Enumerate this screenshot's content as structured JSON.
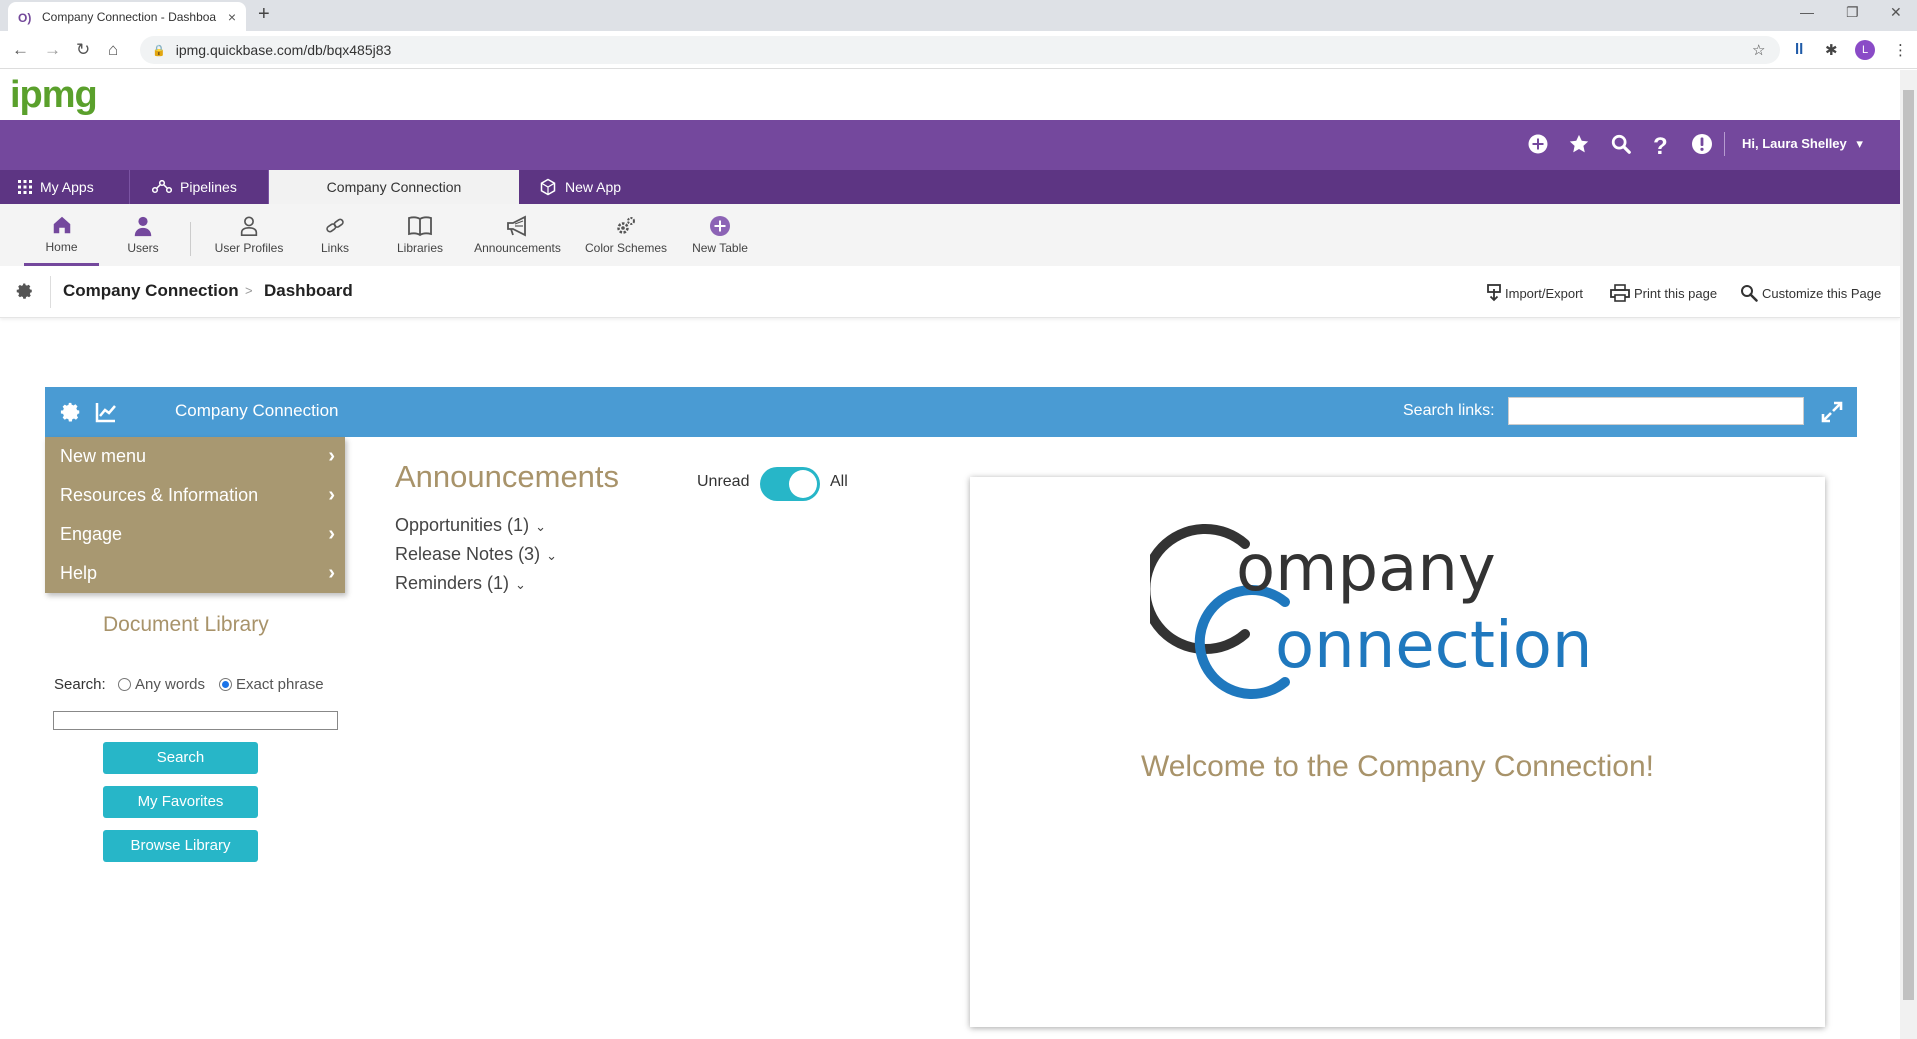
{
  "browser": {
    "tab_title": "Company Connection - Dashboa",
    "tab_favicon": "O)",
    "url": "ipmg.quickbase.com/db/bqx485j83",
    "new_tab": "+",
    "close_tab": "×",
    "avatar_initial": "L"
  },
  "header": {
    "logo": "ipmg",
    "user_greeting": "Hi, Laura Shelley"
  },
  "app_tabs": {
    "my_apps": "My Apps",
    "pipelines": "Pipelines",
    "company_connection": "Company Connection",
    "new_app": "New App"
  },
  "toolbar": {
    "home": "Home",
    "users": "Users",
    "user_profiles": "User Profiles",
    "links": "Links",
    "libraries": "Libraries",
    "announcements": "Announcements",
    "color_schemes": "Color Schemes",
    "new_table": "New Table"
  },
  "breadcrumb": {
    "app": "Company Connection",
    "page": "Dashboard",
    "separator": ">"
  },
  "page_actions": {
    "import_export": "Import/Export",
    "print": "Print this page",
    "customize": "Customize this Page"
  },
  "banner": {
    "title": "Company Connection",
    "search_links_label": "Search links:",
    "search_links_value": ""
  },
  "left_menu": {
    "items": [
      "New menu",
      "Resources & Information",
      "Engage",
      "Help"
    ]
  },
  "document_library": {
    "title": "Document Library",
    "search_label": "Search:",
    "option_any": "Any words",
    "option_exact": "Exact phrase",
    "selected_option": "Exact phrase",
    "search_value": "",
    "buttons": [
      "Search",
      "My Favorites",
      "Browse Library"
    ]
  },
  "announcements": {
    "title": "Announcements",
    "toggle_left": "Unread",
    "toggle_right": "All",
    "toggle_state": "All",
    "items": [
      "Opportunities (1)",
      "Release Notes (3)",
      "Reminders (1)"
    ]
  },
  "welcome_card": {
    "logo_line1": "ompany",
    "logo_line2": "onnection",
    "welcome_text": "Welcome to the Company Connection!",
    "logo_dark_color": "#333333",
    "logo_blue_color": "#1f78be"
  },
  "colors": {
    "purple": "#74489d",
    "purple_dark": "#5d3583",
    "banner_blue": "#4a9bd3",
    "menu_tan": "#a89871",
    "teal": "#27b6c8",
    "heading_tan": "#a8936a",
    "logo_green": "#5aa02c"
  }
}
